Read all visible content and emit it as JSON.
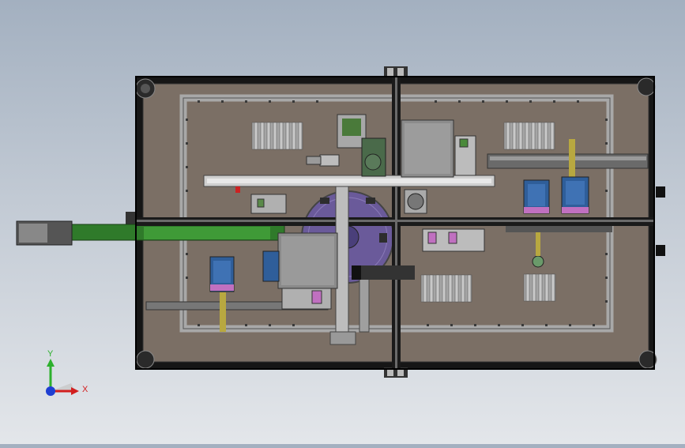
{
  "view": {
    "background_top": "#a3b0c0",
    "background_bottom": "#e3e6ea",
    "model": "machine-top-view"
  },
  "colors": {
    "frame_dark": "#1c1c1c",
    "plate": "#7b6f65",
    "rail": "#9a9a9a",
    "conveyor_green": "#2f7a2a",
    "motor_blue": "#2f5e9a",
    "disc_purple": "#6a5a9a",
    "block_gray": "#8a8a8a"
  },
  "triad": {
    "x_label": "X",
    "y_label": "Y",
    "x_color": "#d21f1f",
    "y_color": "#2db02d",
    "z_color": "#1f3fd2",
    "icon": "coordinate-triad-icon"
  }
}
